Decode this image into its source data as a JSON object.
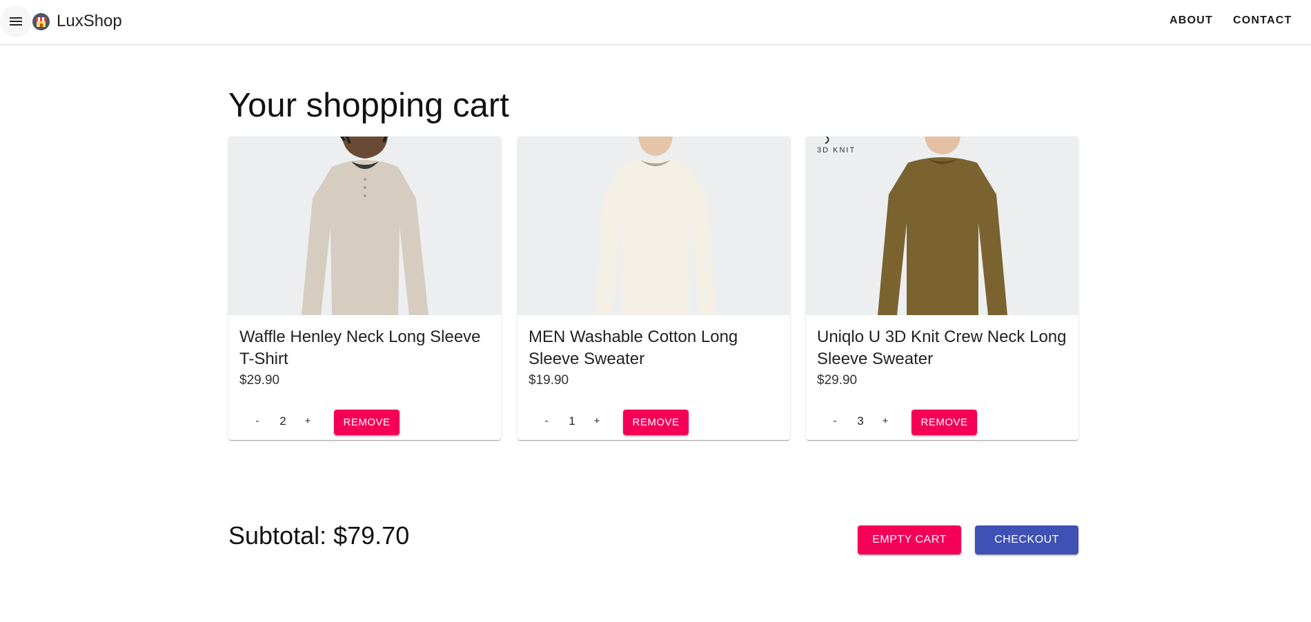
{
  "app": {
    "brand": "LuxShop",
    "logo_icon": "shop-store-icon"
  },
  "nav": {
    "menu_icon": "hamburger-menu-icon",
    "about": "ABOUT",
    "contact": "CONTACT"
  },
  "page": {
    "title": "Your shopping cart"
  },
  "cart": {
    "items": [
      {
        "name": "Waffle Henley Neck Long Sleeve T-Shirt",
        "price": "$29.90",
        "quantity": "2",
        "minus": "-",
        "plus": "+",
        "remove": "REMOVE",
        "image_tag": "",
        "sweater_color": "#d6ccbf"
      },
      {
        "name": "MEN Washable Cotton Long Sleeve Sweater",
        "price": "$19.90",
        "quantity": "1",
        "minus": "-",
        "plus": "+",
        "remove": "REMOVE",
        "image_tag": "",
        "sweater_color": "#f3efe4"
      },
      {
        "name": "Uniqlo U 3D Knit Crew Neck Long Sleeve Sweater",
        "price": "$29.90",
        "quantity": "3",
        "minus": "-",
        "plus": "+",
        "remove": "REMOVE",
        "image_tag": "3D KNIT",
        "sweater_color": "#7b6330"
      }
    ]
  },
  "summary": {
    "subtotal": "Subtotal: $79.70",
    "empty_cart": "EMPTY CART",
    "checkout": "CHECKOUT"
  },
  "colors": {
    "accent_pink": "#f50057",
    "primary_indigo": "#3f51b5",
    "image_bg": "#eceef0"
  }
}
